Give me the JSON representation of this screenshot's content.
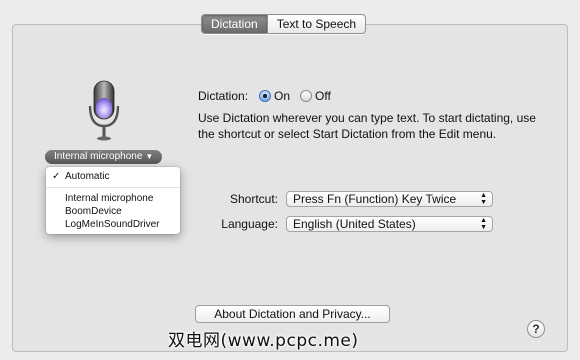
{
  "tabs": [
    "Dictation",
    "Text to Speech"
  ],
  "active_tab": 0,
  "mic_source": {
    "label": "Internal microphone",
    "menu": {
      "selected": "Automatic",
      "items": [
        "Automatic",
        "Internal microphone",
        "BoomDevice",
        "LogMeInSoundDriver"
      ]
    }
  },
  "dictation": {
    "label": "Dictation:",
    "on_label": "On",
    "off_label": "Off",
    "selected": "On",
    "description": "Use Dictation wherever you can type text. To start dictating, use the shortcut or select Start Dictation from the Edit menu."
  },
  "shortcut": {
    "label": "Shortcut:",
    "value": "Press Fn (Function) Key Twice"
  },
  "language": {
    "label": "Language:",
    "value": "English (United States)"
  },
  "about_button": "About Dictation and Privacy...",
  "help_glyph": "?",
  "watermark": "双电网(www.pcpc.me)",
  "colors": {
    "background": "#ececec",
    "panel": "#e4e4e4",
    "active_tab": "#7a7a7a",
    "radio_selected": "#7cabe6",
    "mic_glow": "#b9a7f3"
  }
}
